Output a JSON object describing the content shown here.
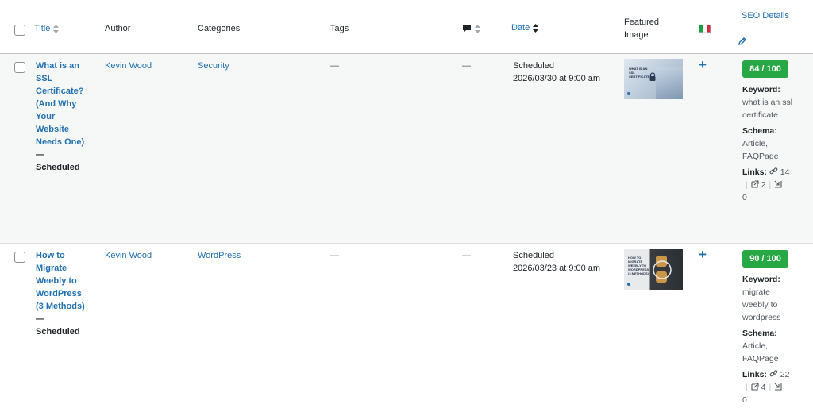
{
  "header": {
    "title": "Title",
    "author": "Author",
    "categories": "Categories",
    "tags": "Tags",
    "date": "Date",
    "featured_line1": "Featured",
    "featured_line2": "Image",
    "seo": "SEO Details"
  },
  "rows": [
    {
      "title_lines": [
        "What is an",
        "SSL",
        "Certificate?",
        "(And Why",
        "Your",
        "Website",
        "Needs One)"
      ],
      "dash": "—",
      "state": "Scheduled",
      "author": "Kevin Wood",
      "category": "Security",
      "tags": "—",
      "comments": "—",
      "date_status": "Scheduled",
      "date_value": "2026/03/30 at 9:00 am",
      "thumb_text": "WHAT IS AN SSL CERTIFICATE?",
      "score": "84 / 100",
      "keyword_label": "Keyword:",
      "keyword_lines": [
        "what is an ssl",
        "certificate"
      ],
      "schema_label": "Schema:",
      "schema_lines": [
        "Article,",
        "FAQPage"
      ],
      "links_label": "Links:",
      "links_internal": "14",
      "links_external": "2",
      "links_incoming": "0"
    },
    {
      "title_lines": [
        "How to",
        "Migrate",
        "Weebly to",
        "WordPress",
        "(3 Methods)"
      ],
      "dash": "—",
      "state": "Scheduled",
      "author": "Kevin Wood",
      "category": "WordPress",
      "tags": "—",
      "comments": "—",
      "date_status": "Scheduled",
      "date_value": "2026/03/23 at 9:00 am",
      "thumb_text": "HOW TO MIGRATE WEEBLY TO WORDPRESS (3 METHODS)",
      "score": "90 / 100",
      "keyword_label": "Keyword:",
      "keyword_lines": [
        "migrate",
        "weebly to",
        "wordpress"
      ],
      "schema_label": "Schema:",
      "schema_lines": [
        "Article,",
        "FAQPage"
      ],
      "links_label": "Links:",
      "links_internal": "22",
      "links_external": "4",
      "links_incoming": "0"
    }
  ],
  "colors": {
    "link": "#2271b1",
    "score_good": "#28a745",
    "row_alt_bg": "#f6f7f7"
  },
  "icons": {
    "comments": "comment-bubble-icon",
    "language": "italy-flag-icon",
    "edit": "pencil-icon",
    "add": "plus-icon",
    "internal_links": "link-icon",
    "external_links": "external-link-icon",
    "incoming_links": "incoming-link-icon"
  }
}
